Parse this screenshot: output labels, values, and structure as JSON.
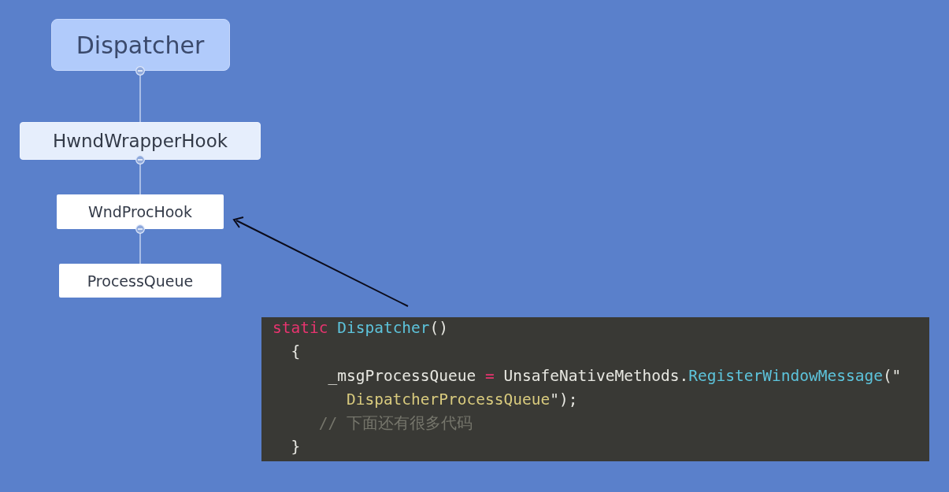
{
  "mind_map": {
    "root": {
      "label": "Dispatcher",
      "kind": "central",
      "expanded": true,
      "children": [
        {
          "label": "HwndWrapperHook",
          "kind": "main",
          "expanded": true,
          "children": [
            {
              "label": "WndProcHook",
              "kind": "sub",
              "expanded": true,
              "children": [
                {
                  "label": "ProcessQueue",
                  "kind": "leaf",
                  "expanded": false
                }
              ]
            }
          ]
        }
      ]
    }
  },
  "code_block": {
    "lines": [
      [
        {
          "text": "static",
          "kind": "keyword"
        },
        {
          "text": " Dispatcher",
          "kind": "type"
        },
        {
          "text": "()",
          "kind": "plain"
        }
      ],
      [
        {
          "text": "  {",
          "kind": "plain"
        }
      ],
      [
        {
          "text": "      _msgProcessQueue ",
          "kind": "plain"
        },
        {
          "text": "=",
          "kind": "keyword"
        },
        {
          "text": " UnsafeNativeMethods.",
          "kind": "plain"
        },
        {
          "text": "RegisterWindowMessage",
          "kind": "type"
        },
        {
          "text": "(\"",
          "kind": "plain"
        }
      ],
      [
        {
          "text": "        DispatcherProcessQueue",
          "kind": "string"
        },
        {
          "text": "\");",
          "kind": "plain"
        }
      ],
      [
        {
          "text": "     // 下面还有很多代码",
          "kind": "comment"
        }
      ],
      [
        {
          "text": "  }",
          "kind": "plain"
        }
      ]
    ]
  }
}
